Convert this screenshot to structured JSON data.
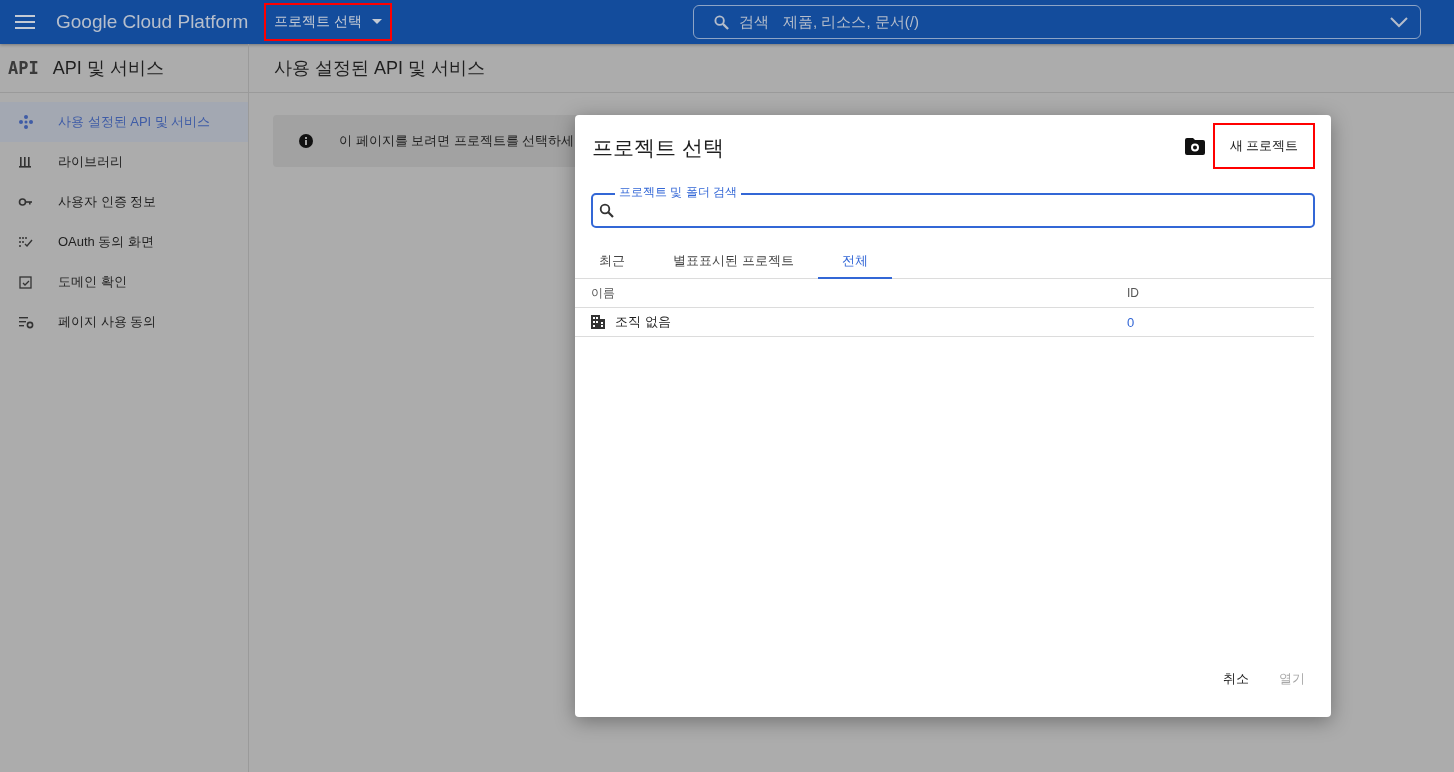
{
  "header": {
    "brand": "Google Cloud Platform",
    "project_picker": {
      "label": "프로젝트 선택",
      "highlighted": true
    },
    "search": {
      "label": "검색",
      "placeholder": "제품, 리소스, 문서(/)"
    }
  },
  "sidebar": {
    "logo_text": "API",
    "title": "API 및 서비스",
    "items": [
      {
        "label": "사용 설정된 API 및 서비스",
        "kind": "dots",
        "selected": true
      },
      {
        "label": "라이브러리",
        "kind": "library",
        "selected": false
      },
      {
        "label": "사용자 인증 정보",
        "kind": "key",
        "selected": false
      },
      {
        "label": "OAuth 동의 화면",
        "kind": "consent",
        "selected": false
      },
      {
        "label": "도메인 확인",
        "kind": "check",
        "selected": false
      },
      {
        "label": "페이지 사용 동의",
        "kind": "settings",
        "selected": false
      }
    ]
  },
  "main": {
    "title": "사용 설정된 API 및 서비스",
    "banner": "이 페이지를 보려면 프로젝트를 선택하세"
  },
  "dialog": {
    "title": "프로젝트 선택",
    "new_project": {
      "label": "새 프로젝트",
      "highlighted": true
    },
    "search_label": "프로젝트 및 폴더 검색",
    "tabs": [
      {
        "label": "최근",
        "selected": false
      },
      {
        "label": "별표표시된 프로젝트",
        "selected": false
      },
      {
        "label": "전체",
        "selected": true
      }
    ],
    "table": {
      "columns": [
        "이름",
        "ID"
      ],
      "rows": [
        {
          "name": "조직 없음",
          "id": "0"
        }
      ]
    },
    "buttons": [
      {
        "label": "취소",
        "disabled": false
      },
      {
        "label": "열기",
        "disabled": true
      }
    ]
  }
}
